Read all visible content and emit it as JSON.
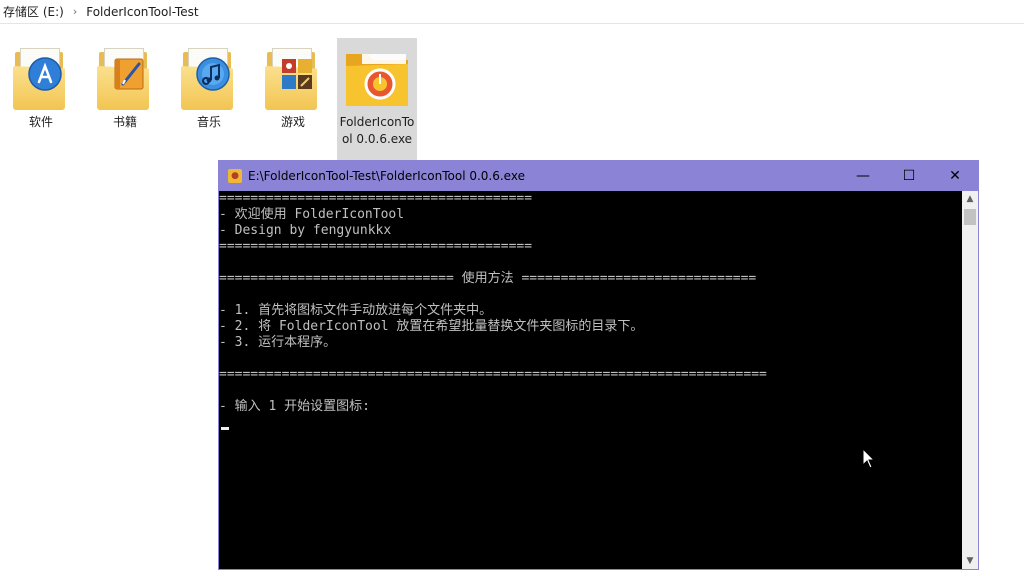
{
  "address_bar": {
    "crumbs": [
      "存储区 (E:)",
      "FolderIconTool-Test"
    ]
  },
  "files": [
    {
      "label": "软件",
      "icon": "app-store-folder-icon",
      "badge_color": "#2f7fd8"
    },
    {
      "label": "书籍",
      "icon": "ibooks-folder-icon",
      "badge_color": "#e88a1a"
    },
    {
      "label": "音乐",
      "icon": "itunes-folder-icon",
      "badge_color": "#3b8fe0"
    },
    {
      "label": "游戏",
      "icon": "game-center-folder-icon",
      "badge_color": "#c8a04a"
    },
    {
      "label": "FolderIconTool 0.0.6.exe",
      "icon": "foldericontool-exe-icon",
      "badge_color": "#e8572f"
    }
  ],
  "console": {
    "title": "E:\\FolderIconTool-Test\\FolderIconTool 0.0.6.exe",
    "window_buttons": {
      "minimize": "—",
      "maximize": "☐",
      "close": "✕"
    },
    "lines": [
      "========================================",
      "- 欢迎使用 FolderIconTool",
      "- Design by fengyunkkx",
      "========================================",
      "",
      "============================== 使用方法 ==============================",
      "",
      "- 1. 首先将图标文件手动放进每个文件夹中。",
      "- 2. 将 FolderIconTool 放置在希望批量替换文件夹图标的目录下。",
      "- 3. 运行本程序。",
      "",
      "======================================================================",
      "",
      "- 输入 1 开始设置图标:"
    ],
    "scroll_up": "▲",
    "scroll_down": "▼"
  },
  "colors": {
    "title_bar": "#8b84d6",
    "console_bg": "#000000",
    "console_text": "#c0c0c0",
    "selection": "#d9d9d9"
  }
}
